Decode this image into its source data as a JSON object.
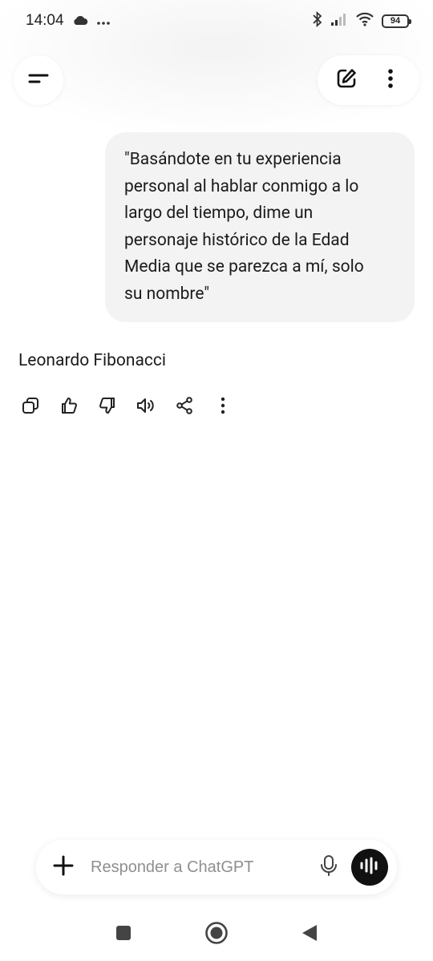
{
  "status_bar": {
    "time": "14:04",
    "battery_level": "94",
    "icons": [
      "cloud-icon",
      "more-dots-icon",
      "bluetooth-icon",
      "signal-icon",
      "wifi-icon",
      "battery-icon"
    ]
  },
  "header": {
    "menu_icon": "menu-icon",
    "new_chat_icon": "edit-icon",
    "more_icon": "more-vertical-icon"
  },
  "conversation": {
    "user_message": "\"Basándote en tu experiencia personal al hablar conmigo a lo largo del tiempo, dime un personaje histórico de la Edad Media que se parezca a mí, solo su nombre\"",
    "user_message_lines": [
      "\"Basándote en tu experiencia",
      "personal al hablar conmigo a lo",
      "largo del tiempo, dime un",
      "personaje histórico de la Edad",
      "Media que se parezca a mí, solo",
      "su nombre\""
    ],
    "assistant_message": "Leonardo Fibonacci",
    "actions": [
      "copy-icon",
      "thumbs-up-icon",
      "thumbs-down-icon",
      "read-aloud-icon",
      "share-icon",
      "more-vertical-icon"
    ]
  },
  "composer": {
    "placeholder": "Responder a ChatGPT",
    "value": ""
  },
  "nav_bar": {
    "buttons": [
      "recents-icon",
      "home-icon",
      "back-icon"
    ]
  },
  "colors": {
    "bubble": "#f3f3f3",
    "voice_button": "#111111",
    "placeholder": "#8f8f8f"
  }
}
